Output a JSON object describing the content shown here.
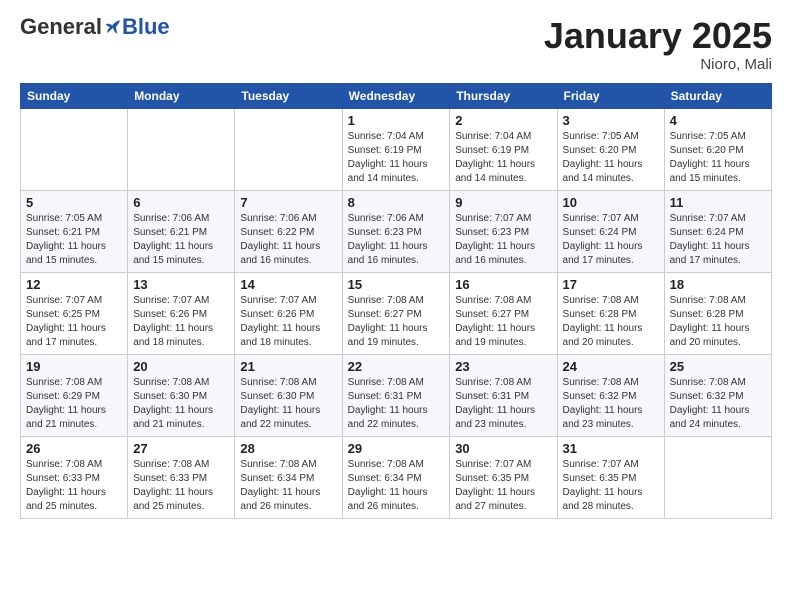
{
  "header": {
    "logo": {
      "general": "General",
      "blue": "Blue"
    },
    "title": "January 2025",
    "location": "Nioro, Mali"
  },
  "weekdays": [
    "Sunday",
    "Monday",
    "Tuesday",
    "Wednesday",
    "Thursday",
    "Friday",
    "Saturday"
  ],
  "weeks": [
    [
      {
        "day": "",
        "info": ""
      },
      {
        "day": "",
        "info": ""
      },
      {
        "day": "",
        "info": ""
      },
      {
        "day": "1",
        "info": "Sunrise: 7:04 AM\nSunset: 6:19 PM\nDaylight: 11 hours\nand 14 minutes."
      },
      {
        "day": "2",
        "info": "Sunrise: 7:04 AM\nSunset: 6:19 PM\nDaylight: 11 hours\nand 14 minutes."
      },
      {
        "day": "3",
        "info": "Sunrise: 7:05 AM\nSunset: 6:20 PM\nDaylight: 11 hours\nand 14 minutes."
      },
      {
        "day": "4",
        "info": "Sunrise: 7:05 AM\nSunset: 6:20 PM\nDaylight: 11 hours\nand 15 minutes."
      }
    ],
    [
      {
        "day": "5",
        "info": "Sunrise: 7:05 AM\nSunset: 6:21 PM\nDaylight: 11 hours\nand 15 minutes."
      },
      {
        "day": "6",
        "info": "Sunrise: 7:06 AM\nSunset: 6:21 PM\nDaylight: 11 hours\nand 15 minutes."
      },
      {
        "day": "7",
        "info": "Sunrise: 7:06 AM\nSunset: 6:22 PM\nDaylight: 11 hours\nand 16 minutes."
      },
      {
        "day": "8",
        "info": "Sunrise: 7:06 AM\nSunset: 6:23 PM\nDaylight: 11 hours\nand 16 minutes."
      },
      {
        "day": "9",
        "info": "Sunrise: 7:07 AM\nSunset: 6:23 PM\nDaylight: 11 hours\nand 16 minutes."
      },
      {
        "day": "10",
        "info": "Sunrise: 7:07 AM\nSunset: 6:24 PM\nDaylight: 11 hours\nand 17 minutes."
      },
      {
        "day": "11",
        "info": "Sunrise: 7:07 AM\nSunset: 6:24 PM\nDaylight: 11 hours\nand 17 minutes."
      }
    ],
    [
      {
        "day": "12",
        "info": "Sunrise: 7:07 AM\nSunset: 6:25 PM\nDaylight: 11 hours\nand 17 minutes."
      },
      {
        "day": "13",
        "info": "Sunrise: 7:07 AM\nSunset: 6:26 PM\nDaylight: 11 hours\nand 18 minutes."
      },
      {
        "day": "14",
        "info": "Sunrise: 7:07 AM\nSunset: 6:26 PM\nDaylight: 11 hours\nand 18 minutes."
      },
      {
        "day": "15",
        "info": "Sunrise: 7:08 AM\nSunset: 6:27 PM\nDaylight: 11 hours\nand 19 minutes."
      },
      {
        "day": "16",
        "info": "Sunrise: 7:08 AM\nSunset: 6:27 PM\nDaylight: 11 hours\nand 19 minutes."
      },
      {
        "day": "17",
        "info": "Sunrise: 7:08 AM\nSunset: 6:28 PM\nDaylight: 11 hours\nand 20 minutes."
      },
      {
        "day": "18",
        "info": "Sunrise: 7:08 AM\nSunset: 6:28 PM\nDaylight: 11 hours\nand 20 minutes."
      }
    ],
    [
      {
        "day": "19",
        "info": "Sunrise: 7:08 AM\nSunset: 6:29 PM\nDaylight: 11 hours\nand 21 minutes."
      },
      {
        "day": "20",
        "info": "Sunrise: 7:08 AM\nSunset: 6:30 PM\nDaylight: 11 hours\nand 21 minutes."
      },
      {
        "day": "21",
        "info": "Sunrise: 7:08 AM\nSunset: 6:30 PM\nDaylight: 11 hours\nand 22 minutes."
      },
      {
        "day": "22",
        "info": "Sunrise: 7:08 AM\nSunset: 6:31 PM\nDaylight: 11 hours\nand 22 minutes."
      },
      {
        "day": "23",
        "info": "Sunrise: 7:08 AM\nSunset: 6:31 PM\nDaylight: 11 hours\nand 23 minutes."
      },
      {
        "day": "24",
        "info": "Sunrise: 7:08 AM\nSunset: 6:32 PM\nDaylight: 11 hours\nand 23 minutes."
      },
      {
        "day": "25",
        "info": "Sunrise: 7:08 AM\nSunset: 6:32 PM\nDaylight: 11 hours\nand 24 minutes."
      }
    ],
    [
      {
        "day": "26",
        "info": "Sunrise: 7:08 AM\nSunset: 6:33 PM\nDaylight: 11 hours\nand 25 minutes."
      },
      {
        "day": "27",
        "info": "Sunrise: 7:08 AM\nSunset: 6:33 PM\nDaylight: 11 hours\nand 25 minutes."
      },
      {
        "day": "28",
        "info": "Sunrise: 7:08 AM\nSunset: 6:34 PM\nDaylight: 11 hours\nand 26 minutes."
      },
      {
        "day": "29",
        "info": "Sunrise: 7:08 AM\nSunset: 6:34 PM\nDaylight: 11 hours\nand 26 minutes."
      },
      {
        "day": "30",
        "info": "Sunrise: 7:07 AM\nSunset: 6:35 PM\nDaylight: 11 hours\nand 27 minutes."
      },
      {
        "day": "31",
        "info": "Sunrise: 7:07 AM\nSunset: 6:35 PM\nDaylight: 11 hours\nand 28 minutes."
      },
      {
        "day": "",
        "info": ""
      }
    ]
  ]
}
